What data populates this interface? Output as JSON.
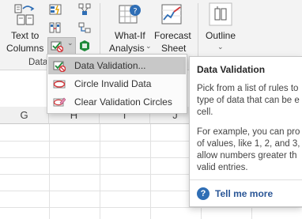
{
  "ribbon": {
    "text_to_columns": [
      "Text to",
      "Columns"
    ],
    "group_data_tools_partial": "Data",
    "what_if": [
      "What-If",
      "Analysis"
    ],
    "forecast": [
      "Forecast",
      "Sheet"
    ],
    "outline": "Outline",
    "dropdown_chevron": "⌄"
  },
  "columns": [
    "G",
    "H",
    "I",
    "J"
  ],
  "menu": {
    "items": [
      {
        "label": "Data Validation...",
        "icon": "data-validation-icon"
      },
      {
        "label": "Circle Invalid Data",
        "icon": "circle-invalid-icon"
      },
      {
        "label": "Clear Validation Circles",
        "icon": "clear-circles-icon"
      }
    ]
  },
  "tooltip": {
    "title": "Data Validation",
    "para1": [
      "Pick from a list of rules to",
      "type of data that can be e",
      "cell."
    ],
    "para2": [
      "For example, you can pro",
      "of values, like 1, 2, and 3,",
      "allow numbers greater th",
      "valid entries."
    ],
    "help_icon": "?",
    "help_text": "Tell me more"
  },
  "colors": {
    "accent_blue": "#2b5797",
    "green_check": "#1f8a3a",
    "red_x": "#d13438"
  }
}
